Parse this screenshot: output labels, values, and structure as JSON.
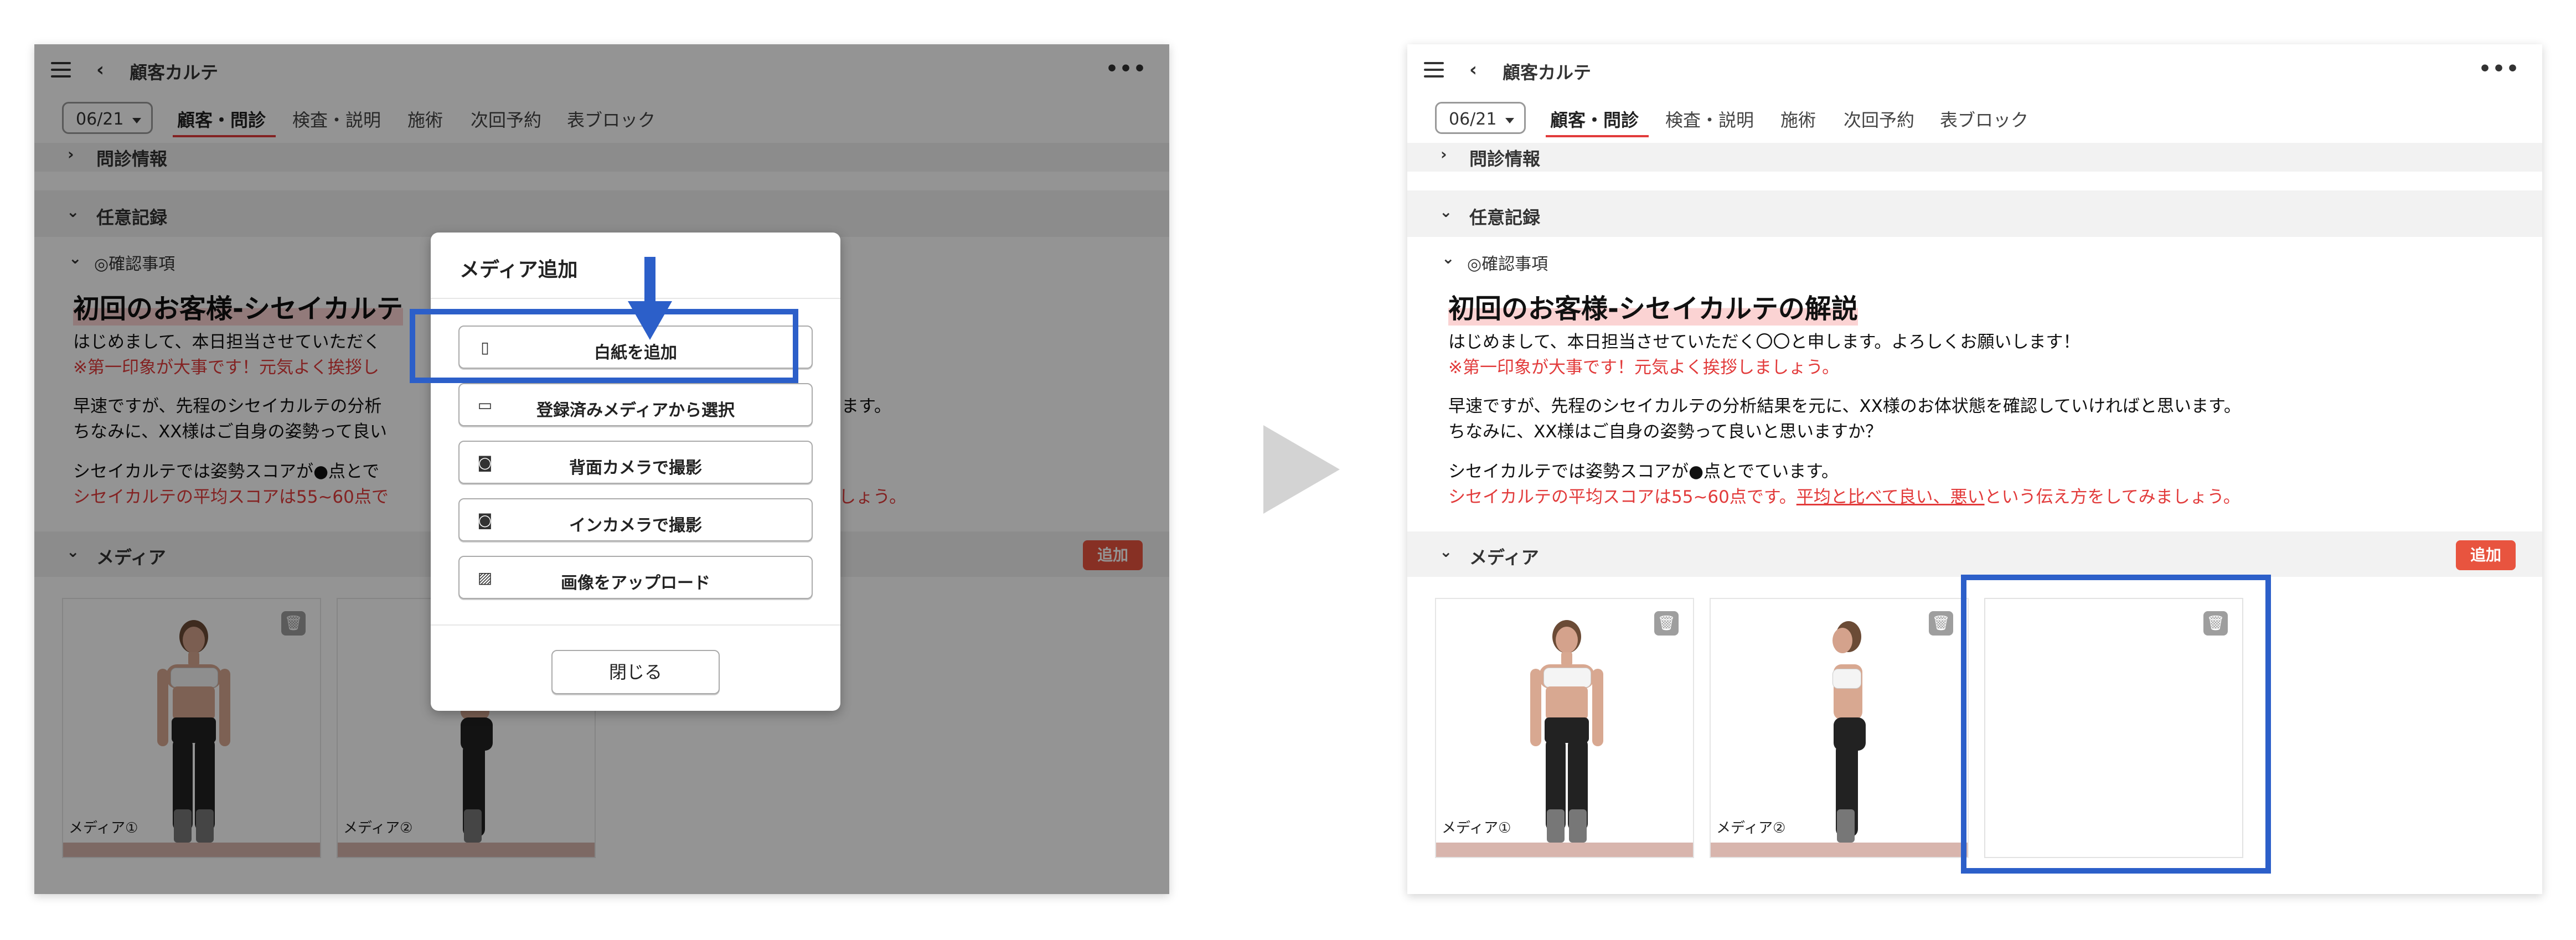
{
  "header": {
    "title": "顧客カルテ",
    "menu_icon": "hamburger-icon",
    "back_icon": "chevron-left-icon",
    "more_icon": "more-horizontal-icon"
  },
  "date_select": {
    "value": "06/21"
  },
  "tabs": [
    {
      "label": "顧客・問診",
      "active": true
    },
    {
      "label": "検査・説明"
    },
    {
      "label": "施術"
    },
    {
      "label": "次回予約"
    },
    {
      "label": "表ブロック"
    }
  ],
  "sections": {
    "monshin": "問診情報",
    "nini": "任意記録",
    "kakunin": "◎確認事項",
    "media": "メディア"
  },
  "content": {
    "heading": "初回のお客様-シセイカルテの解説",
    "line1": "はじめまして、本日担当させていただく〇〇と申します。よろしくお願いします！",
    "line2_red": "※第一印象が大事です！元気よく挨拶しましょう。",
    "line3": "早速ですが、先程のシセイカルテの分析結果を元に、XX様のお体状態を確認していければと思います。",
    "line4": "ちなみに、XX様はご自身の姿勢って良いと思いますか？",
    "line5": "シセイカルテでは姿勢スコアが●点とでています。",
    "line6_red_a": "シセイカルテの平均スコアは55~60点です。",
    "line6_red_b": "平均と比べて良い、悪い",
    "line6_red_c": "という伝え方をしてみましょう。"
  },
  "left_partial": {
    "heading": "初回のお客様-シセイカルテ",
    "line1": "はじめまして、本日担当させていただく",
    "line2_red": "※第一印象が大事です！元気よく挨拶し",
    "line3a": "早速ですが、先程のシセイカルテの分析",
    "line3b": "思います。",
    "line4": "ちなみに、XX様はご自身の姿勢って良い",
    "line5": "シセイカルテでは姿勢スコアが●点とで",
    "line6a": "シセイカルテの平均スコアは55~60点で",
    "line6b": "ましょう。"
  },
  "media": {
    "add_label": "追加",
    "items": [
      {
        "label": "メディア①"
      },
      {
        "label": "メディア②"
      }
    ],
    "delete_icon": "trash-icon"
  },
  "modal": {
    "title": "メディア追加",
    "options": [
      {
        "label": "白紙を追加",
        "icon": "clipboard-icon"
      },
      {
        "label": "登録済みメディアから選択",
        "icon": "folder-icon"
      },
      {
        "label": "背面カメラで撮影",
        "icon": "camera-icon"
      },
      {
        "label": "インカメラで撮影",
        "icon": "camera-icon"
      },
      {
        "label": "画像をアップロード",
        "icon": "image-icon"
      }
    ],
    "close_label": "閉じる"
  },
  "colors": {
    "accent_red": "#e23b3b",
    "highlight_blue": "#2c5fc9",
    "add_button": "#e8543f"
  }
}
